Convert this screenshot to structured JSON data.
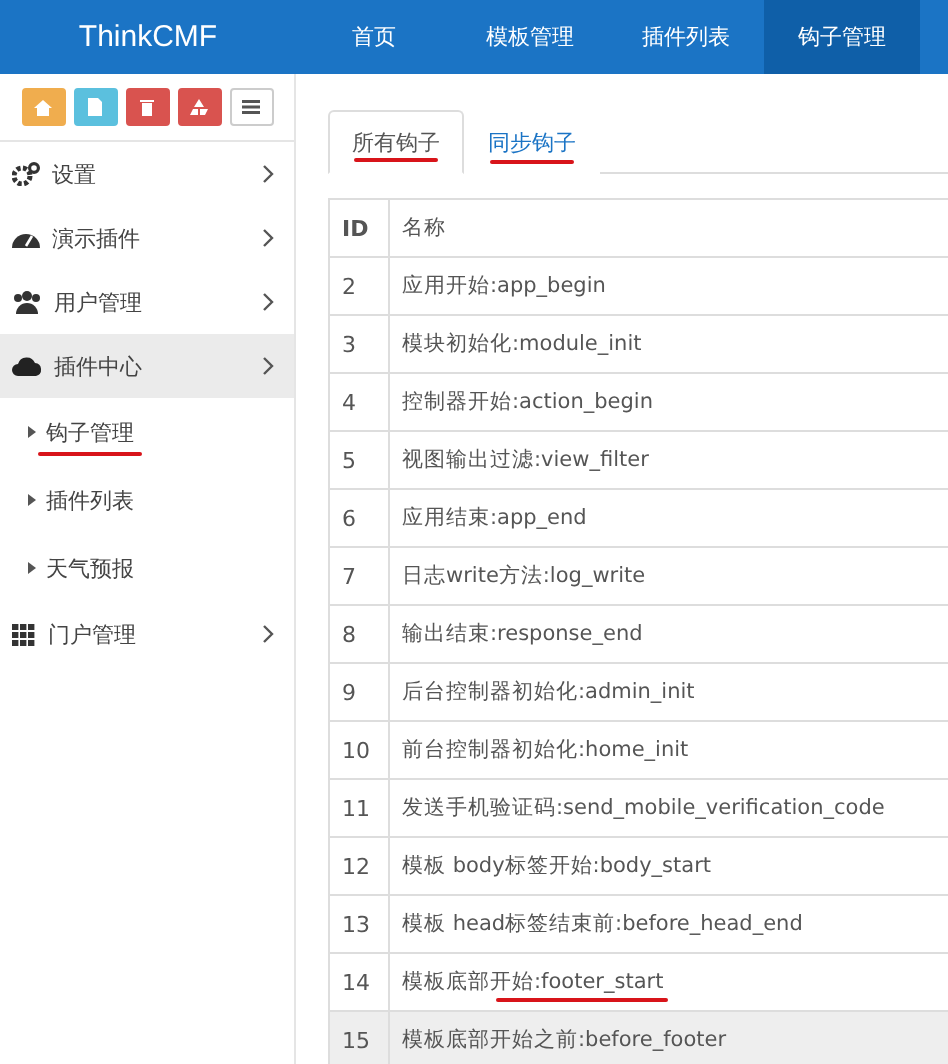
{
  "brand": "ThinkCMF",
  "nav": [
    {
      "label": "首页",
      "selected": false
    },
    {
      "label": "模板管理",
      "selected": false
    },
    {
      "label": "插件列表",
      "selected": false
    },
    {
      "label": "钩子管理",
      "selected": true
    }
  ],
  "toolbar": [
    {
      "kind": "home",
      "color": "#f0ad4e"
    },
    {
      "kind": "file",
      "color": "#5bc0de"
    },
    {
      "kind": "trash",
      "color": "#d9534f"
    },
    {
      "kind": "recycle",
      "color": "#d9534f"
    },
    {
      "kind": "list",
      "color": "#ffffff"
    }
  ],
  "sidebar": {
    "items": [
      {
        "label": "设置",
        "kind": "gears",
        "selected": false
      },
      {
        "label": "演示插件",
        "kind": "dashboard",
        "selected": false
      },
      {
        "label": "用户管理",
        "kind": "users",
        "selected": false
      },
      {
        "label": "插件中心",
        "kind": "cloud",
        "selected": true,
        "children": [
          {
            "label": "钩子管理",
            "annotated": true
          },
          {
            "label": "插件列表",
            "annotated": false
          },
          {
            "label": "天气预报",
            "annotated": false
          }
        ]
      },
      {
        "label": "门户管理",
        "kind": "grid",
        "selected": false
      }
    ]
  },
  "tabs": [
    {
      "label": "所有钩子",
      "selected": true,
      "annotated": true
    },
    {
      "label": "同步钩子",
      "selected": false,
      "annotated": true
    }
  ],
  "table": {
    "columns": [
      "ID",
      "名称"
    ],
    "rows": [
      {
        "id": "2",
        "name": "应用开始:app_begin",
        "annotated": false,
        "hovered": false
      },
      {
        "id": "3",
        "name": "模块初始化:module_init",
        "annotated": false,
        "hovered": false
      },
      {
        "id": "4",
        "name": "控制器开始:action_begin",
        "annotated": false,
        "hovered": false
      },
      {
        "id": "5",
        "name": "视图输出过滤:view_filter",
        "annotated": false,
        "hovered": false
      },
      {
        "id": "6",
        "name": "应用结束:app_end",
        "annotated": false,
        "hovered": false
      },
      {
        "id": "7",
        "name": "日志write方法:log_write",
        "annotated": false,
        "hovered": false
      },
      {
        "id": "8",
        "name": "输出结束:response_end",
        "annotated": false,
        "hovered": false
      },
      {
        "id": "9",
        "name": "后台控制器初始化:admin_init",
        "annotated": false,
        "hovered": false
      },
      {
        "id": "10",
        "name": "前台控制器初始化:home_init",
        "annotated": false,
        "hovered": false
      },
      {
        "id": "11",
        "name": "发送手机验证码:send_mobile_verification_code",
        "annotated": false,
        "hovered": false
      },
      {
        "id": "12",
        "name": "模板 body标签开始:body_start",
        "annotated": false,
        "hovered": false
      },
      {
        "id": "13",
        "name": "模板 head标签结束前:before_head_end",
        "annotated": false,
        "hovered": false
      },
      {
        "id": "14",
        "name": "模板底部开始:footer_start",
        "annotated": true,
        "hovered": false
      },
      {
        "id": "15",
        "name": "模板底部开始之前:before_footer",
        "annotated": false,
        "hovered": true
      }
    ]
  }
}
